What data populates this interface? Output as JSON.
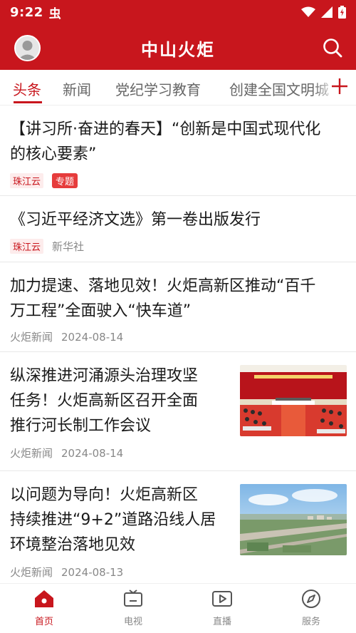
{
  "status_bar": {
    "time": "9:22",
    "notification_glyph": "虫"
  },
  "header": {
    "title": "中山火炬",
    "avatar_icon": "user-avatar-icon",
    "search_icon": "search-icon"
  },
  "tabs": [
    {
      "label": "头条",
      "active": true
    },
    {
      "label": "新闻",
      "active": false
    },
    {
      "label": "党纪学习教育",
      "active": false
    },
    {
      "label": "创建全国文明城",
      "active": false
    }
  ],
  "articles": [
    {
      "title_line1": "【讲习所·奋进的春天】“创新是中国式现代化",
      "title_line2": "的核心要素”",
      "source": "珠江云",
      "badge": "专题"
    },
    {
      "title_line1": "《习近平经济文选》第一卷出版发行",
      "source": "珠江云",
      "publisher": "新华社"
    },
    {
      "title_line1": "加力提速、落地见效！火炬高新区推动“百千",
      "title_line2": "万工程”全面驶入“快车道”",
      "source": "火炬新闻",
      "date": "2024-08-14"
    },
    {
      "title_line1": "纵深推进河涌源头治理攻坚",
      "title_line2": "任务！火炬高新区召开全面",
      "title_line3": "推行河长制工作会议",
      "source": "火炬新闻",
      "date": "2024-08-14",
      "thumbnail": "conference-hall-photo"
    },
    {
      "title_line1": "以问题为导向！火炬高新区",
      "title_line2": "持续推进“9+2”道路沿线人居",
      "title_line3": "环境整治落地见效",
      "source": "火炬新闻",
      "date": "2024-08-13",
      "thumbnail": "aerial-road-photo"
    }
  ],
  "bottom_nav": [
    {
      "label": "首页",
      "icon": "home-icon",
      "active": true
    },
    {
      "label": "电视",
      "icon": "tv-icon",
      "active": false
    },
    {
      "label": "直播",
      "icon": "live-video-icon",
      "active": false
    },
    {
      "label": "服务",
      "icon": "compass-icon",
      "active": false
    }
  ],
  "colors": {
    "brand_red": "#c8161d",
    "text": "#1a1a1a",
    "muted": "#888888"
  }
}
